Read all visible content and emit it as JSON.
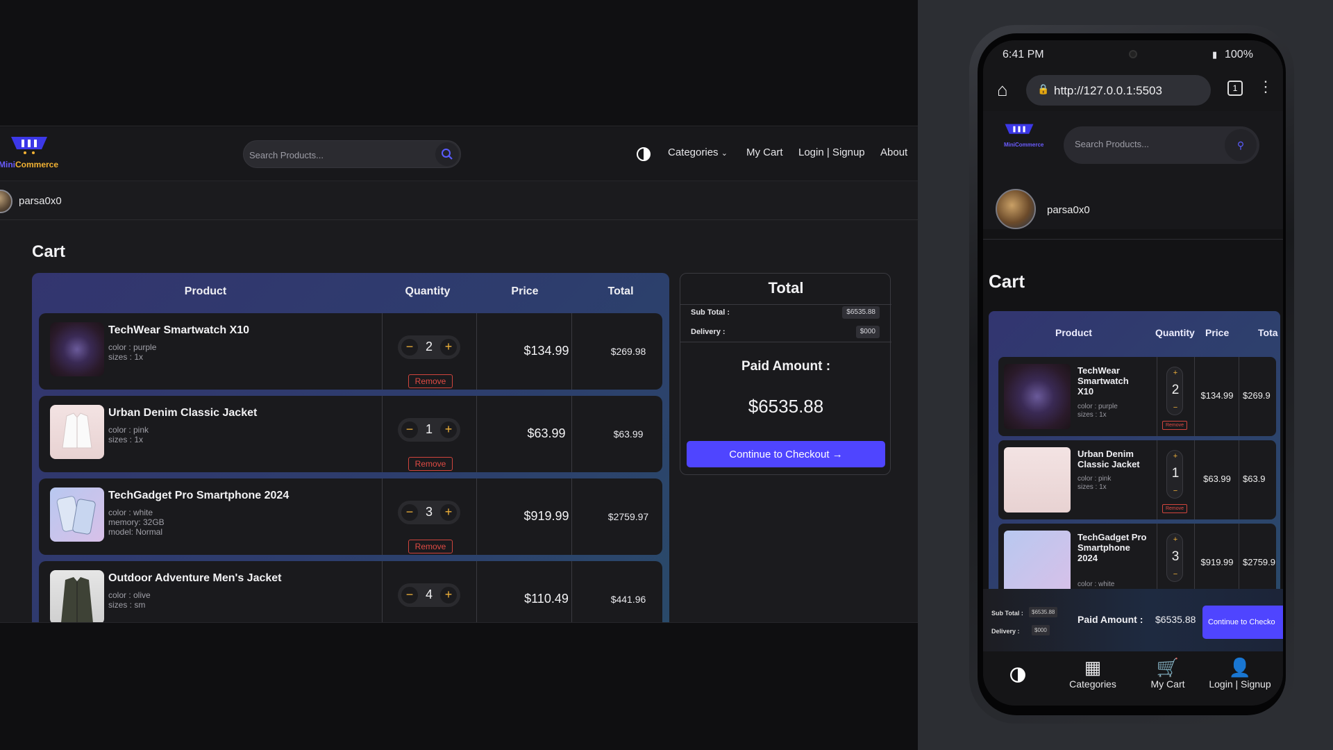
{
  "brand": {
    "logo_part1": "Mini",
    "logo_part2": "Commerce"
  },
  "search": {
    "placeholder": "Search Products..."
  },
  "nav": {
    "categories": "Categories",
    "my_cart": "My Cart",
    "login": "Login | Signup",
    "about": "About"
  },
  "user": {
    "name": "parsa0x0"
  },
  "cart": {
    "title": "Cart",
    "headers": {
      "product": "Product",
      "quantity": "Quantity",
      "price": "Price",
      "total": "Total"
    },
    "remove_label": "Remove",
    "items": [
      {
        "name": "TechWear Smartwatch X10",
        "specs": [
          "color   : purple",
          "sizes   : 1x"
        ],
        "quantity": "2",
        "price": "$134.99",
        "total": "$269.98"
      },
      {
        "name": "Urban Denim Classic Jacket",
        "specs": [
          "color   : pink",
          "sizes   : 1x"
        ],
        "quantity": "1",
        "price": "$63.99",
        "total": "$63.99"
      },
      {
        "name": "TechGadget Pro Smartphone 2024",
        "specs": [
          "color   : white",
          "memory: 32GB",
          "model: Normal"
        ],
        "quantity": "3",
        "price": "$919.99",
        "total": "$2759.97"
      },
      {
        "name": "Outdoor Adventure Men's Jacket",
        "specs": [
          "color   : olive",
          "sizes   : sm"
        ],
        "quantity": "4",
        "price": "$110.49",
        "total": "$441.96"
      }
    ]
  },
  "summary": {
    "title": "Total",
    "subtotal_label": "Sub Total :",
    "subtotal_value": "$6535.88",
    "delivery_label": "Delivery :",
    "delivery_value": "$000",
    "paid_label": "Paid Amount :",
    "paid_value": "$6535.88",
    "checkout_label": "Continue to Checkout"
  },
  "phone": {
    "time": "6:41 PM",
    "battery": "100%",
    "url": "http://127.0.0.1:5503",
    "tab_count": "1",
    "logo_text": "MiniCommerce",
    "cart_title": "Cart",
    "headers": {
      "product": "Product",
      "quantity": "Quantity",
      "price": "Price",
      "total": "Tota"
    },
    "items": [
      {
        "name": "TechWear Smartwatch X10",
        "spec1": "color      :  purple",
        "spec2": "sizes       :  1x",
        "quantity": "2",
        "price": "$134.99",
        "total": "$269.9"
      },
      {
        "name": "Urban Denim Classic Jacket",
        "spec1": "color      :  pink",
        "spec2": "sizes       :  1x",
        "quantity": "1",
        "price": "$63.99",
        "total": "$63.9"
      },
      {
        "name": "TechGadget Pro Smartphone 2024",
        "spec1": "color      :  white",
        "spec2": "",
        "quantity": "3",
        "price": "$919.99",
        "total": "$2759.9"
      }
    ],
    "remove_label": "Remove",
    "subtotal_label": "Sub Total :",
    "subtotal_value": "$6535.88",
    "delivery_label": "Delivery :",
    "delivery_value": "$000",
    "paid_label": "Paid Amount :",
    "paid_value": "$6535.88",
    "checkout_label": "Continue to Checko",
    "bottom_nav": [
      "Categories",
      "My Cart",
      "Login | Signup"
    ]
  }
}
